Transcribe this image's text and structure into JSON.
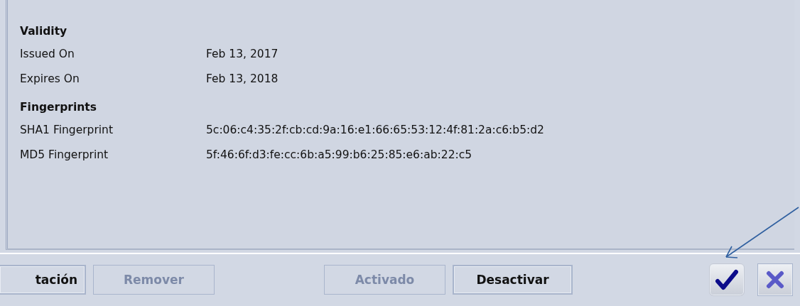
{
  "sections": [
    {
      "title": "Validity",
      "rows": [
        {
          "label": "Issued On",
          "value": "Feb 13, 2017"
        },
        {
          "label": "Expires On",
          "value": "Feb 13, 2018"
        }
      ]
    },
    {
      "title": "Fingerprints",
      "rows": [
        {
          "label": "SHA1 Fingerprint",
          "value": "5c:06:c4:35:2f:cb:cd:9a:16:e1:66:65:53:12:4f:81:2a:c6:b5:d2"
        },
        {
          "label": "MD5 Fingerprint",
          "value": "5f:46:6f:d3:fe:cc:6b:a5:99:b6:25:85:e6:ab:22:c5"
        }
      ]
    }
  ],
  "buttons": [
    {
      "label": "tación",
      "disabled": false
    },
    {
      "label": "Remover",
      "disabled": true
    },
    {
      "label": "Activado",
      "disabled": true
    },
    {
      "label": "Desactivar",
      "disabled": false
    }
  ],
  "dialog_buttons": [
    {
      "kind": "ok"
    },
    {
      "kind": "cancel"
    }
  ]
}
